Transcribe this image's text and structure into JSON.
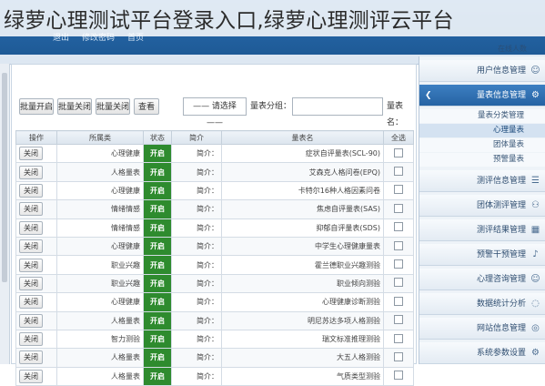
{
  "title": "绿萝心理测试平台登录入口,绿萝心理测评云平台",
  "topbar": {
    "items": [
      "退出",
      "修改密码",
      "首页"
    ],
    "user": "在线人数"
  },
  "toolbar": {
    "open_all": "批量开启",
    "close_all": "批量关闭",
    "close": "批量关闭",
    "view": "查看",
    "category_label": "量表分组：",
    "category_value": "—— 请选择 ——",
    "search_label": "量表名："
  },
  "table": {
    "headers": [
      "操作",
      "所属类",
      "状态",
      "简介",
      "量表名",
      "全选"
    ],
    "rows": [
      {
        "action": "关闭",
        "cat": "心理健康",
        "status": "开启",
        "desc": "简介：",
        "name": "症状自评量表(SCL-90)"
      },
      {
        "action": "关闭",
        "cat": "人格量表",
        "status": "开启",
        "desc": "简介：",
        "name": "艾森克人格问卷(EPQ)"
      },
      {
        "action": "关闭",
        "cat": "心理健康",
        "status": "开启",
        "desc": "简介：",
        "name": "卡特尔16种人格因素问卷"
      },
      {
        "action": "关闭",
        "cat": "情绪情感",
        "status": "开启",
        "desc": "简介：",
        "name": "焦虑自评量表(SAS)"
      },
      {
        "action": "关闭",
        "cat": "情绪情感",
        "status": "开启",
        "desc": "简介：",
        "name": "抑郁自评量表(SDS)"
      },
      {
        "action": "关闭",
        "cat": "心理健康",
        "status": "开启",
        "desc": "简介：",
        "name": "中学生心理健康量表"
      },
      {
        "action": "关闭",
        "cat": "职业兴趣",
        "status": "开启",
        "desc": "简介：",
        "name": "霍兰德职业兴趣测验"
      },
      {
        "action": "关闭",
        "cat": "职业兴趣",
        "status": "开启",
        "desc": "简介：",
        "name": "职业倾向测验"
      },
      {
        "action": "关闭",
        "cat": "心理健康",
        "status": "开启",
        "desc": "简介：",
        "name": "心理健康诊断测验"
      },
      {
        "action": "关闭",
        "cat": "人格量表",
        "status": "开启",
        "desc": "简介：",
        "name": "明尼苏达多项人格测验"
      },
      {
        "action": "关闭",
        "cat": "智力测验",
        "status": "开启",
        "desc": "简介：",
        "name": "瑞文标准推理测验"
      },
      {
        "action": "关闭",
        "cat": "人格量表",
        "status": "开启",
        "desc": "简介：",
        "name": "大五人格测验"
      },
      {
        "action": "关闭",
        "cat": "人格量表",
        "status": "开启",
        "desc": "简介：",
        "name": "气质类型测验"
      }
    ]
  },
  "sidebar": {
    "items": [
      {
        "label": "用户信息管理",
        "icon": "person-icon"
      },
      {
        "label": "量表信息管理",
        "icon": "gear-icon",
        "active": true
      },
      {
        "label": "测评信息管理",
        "icon": "clipboard-icon"
      },
      {
        "label": "团体测评管理",
        "icon": "group-icon"
      },
      {
        "label": "测评结果管理",
        "icon": "chart-icon"
      },
      {
        "label": "预警干预管理",
        "icon": "bell-icon"
      },
      {
        "label": "心理咨询管理",
        "icon": "person-icon"
      },
      {
        "label": "数据统计分析",
        "icon": "chat-icon"
      },
      {
        "label": "网站信息管理",
        "icon": "globe-icon"
      },
      {
        "label": "系统参数设置",
        "icon": "gear-icon"
      }
    ],
    "subitems": [
      "量表分类管理",
      "心理量表",
      "团体量表",
      "预警量表"
    ]
  }
}
